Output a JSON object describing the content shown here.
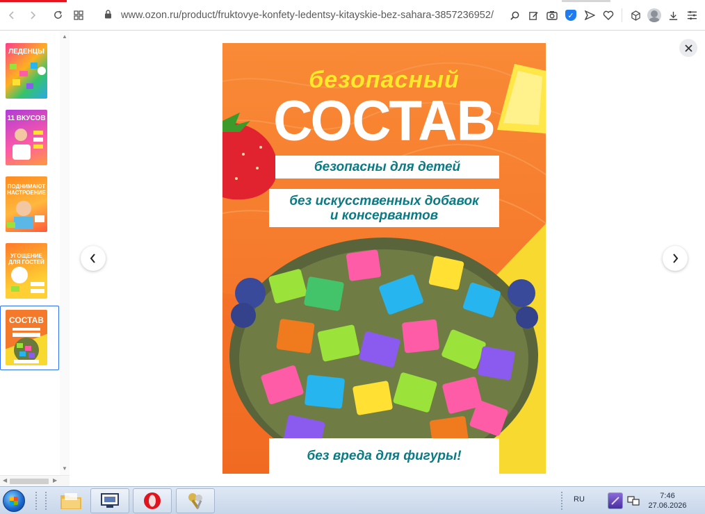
{
  "browser": {
    "url": "www.ozon.ru/product/fruktovye-konfety-ledentsy-kitayskie-bez-sahara-3857236952/"
  },
  "thumbnails": [
    {
      "title": "ЛЕДЕНЦЫ",
      "selected": false
    },
    {
      "title": "11 ВКУСОВ",
      "selected": false
    },
    {
      "title": "ПОДНИМАЮТ НАСТРОЕНИЕ",
      "selected": false
    },
    {
      "title": "УГОЩЕНИЕ ДЛЯ ГОСТЕЙ",
      "selected": false
    },
    {
      "title": "СОСТАВ",
      "selected": true
    }
  ],
  "image": {
    "headline_small": "безопасный",
    "headline_big": "СОСТАВ",
    "ribbon_1": "безопасны для детей",
    "ribbon_2": "без искусственных добавок и консервантов",
    "ribbon_3": "без вреда для фигуры!"
  },
  "taskbar": {
    "language": "RU",
    "time": "7:46",
    "date": "27.06.2026"
  },
  "colors": {
    "accent": "#e5141f",
    "selection": "#2d6ff0",
    "poster_orange": "#f47a2c",
    "poster_yellow": "#f8d92f",
    "ribbon_text": "#0a7a84"
  }
}
